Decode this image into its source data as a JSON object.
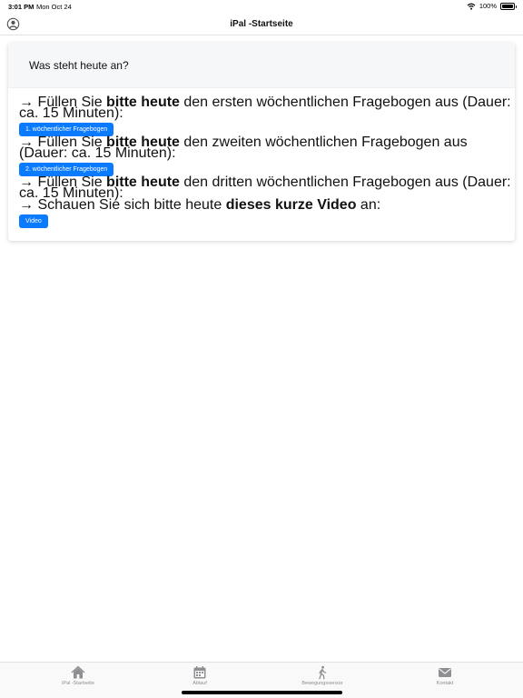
{
  "status": {
    "time": "3:01 PM",
    "date": "Mon Oct 24",
    "battery": "100%"
  },
  "nav": {
    "title": "iPal -Startseite"
  },
  "card": {
    "header": "Was steht heute an?",
    "tasks": [
      {
        "prefix": "→ Füllen Sie ",
        "bold": "bitte heute",
        "suffix": " den ersten wöchentlichen Fragebogen aus (Dauer: ca. 15 Minuten):",
        "button": "1. wöchentlicher Fragebogen"
      },
      {
        "prefix": "→ Füllen Sie ",
        "bold": "bitte heute",
        "suffix": " den zweiten wöchentlichen Fragebogen aus (Dauer: ca. 15 Minuten):",
        "button": "2. wöchentlicher Fragebogen"
      },
      {
        "prefix": "→ Füllen Sie ",
        "bold": "bitte heute",
        "suffix": " den dritten wöchentlichen Fragebogen aus (Dauer: ca. 15 Minuten):"
      },
      {
        "prefix": "→ Schauen Sie sich bitte heute ",
        "bold": "dieses kurze Video",
        "suffix": " an:",
        "button": "Video"
      }
    ]
  },
  "tabs": [
    {
      "label": "iPal -Startseite",
      "icon": "home-icon"
    },
    {
      "label": "Ablauf",
      "icon": "calendar-icon"
    },
    {
      "label": "Bewegungssensor",
      "icon": "walking-icon"
    },
    {
      "label": "Kontakt",
      "icon": "mail-icon"
    }
  ],
  "colors": {
    "accent": "#0a7aff",
    "tab_inactive": "#8e8e93"
  }
}
